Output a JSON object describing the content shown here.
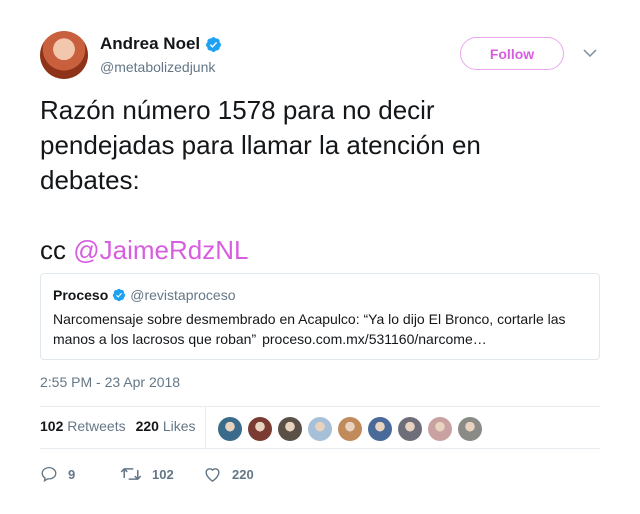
{
  "author": {
    "name": "Andrea Noel",
    "handle": "@metabolizedjunk",
    "verified": true
  },
  "follow_label": "Follow",
  "tweet": {
    "line1": "Razón número 1578 para no decir",
    "line2": "pendejadas para llamar la atención en",
    "line3": "debates:",
    "cc": "cc",
    "mention": "@JaimeRdzNL"
  },
  "quote": {
    "name": "Proceso",
    "handle": "@revistaproceso",
    "text": "Narcomensaje sobre desmembrado en Acapulco: “Ya lo dijo El Bronco, cortarle las manos a los lacrosos que roban”",
    "link": "proceso.com.mx/531160/narcome…"
  },
  "timestamp": "2:55 PM - 23 Apr 2018",
  "stats": {
    "retweets_count": "102",
    "retweets_label": "Retweets",
    "likes_count": "220",
    "likes_label": "Likes"
  },
  "actions": {
    "replies": "9",
    "retweets": "102",
    "likes": "220"
  },
  "colors": {
    "accent": "#d85ee0",
    "verified": "#1da1f2",
    "secondary_text": "#657786"
  },
  "likers_avatar_colors": [
    "#3a6b8a",
    "#7a3b32",
    "#5a5045",
    "#a6c0d8",
    "#c08a5a",
    "#4a6a9a",
    "#6e6e7a",
    "#c9a1a1",
    "#8a8a86"
  ]
}
